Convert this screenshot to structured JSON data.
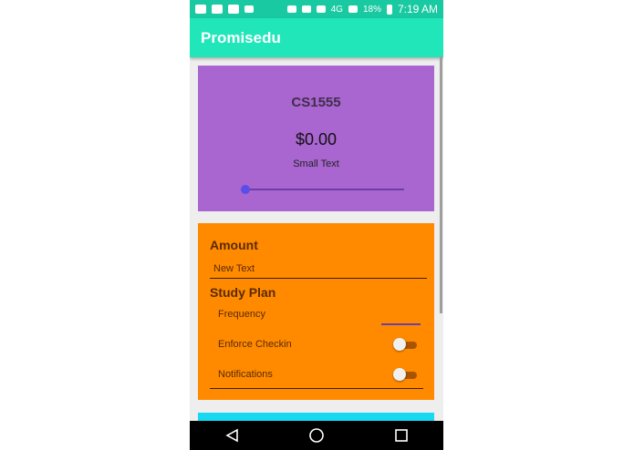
{
  "status_bar": {
    "battery_percent": "18%",
    "time": "7:19 AM",
    "network": "4G"
  },
  "app_bar": {
    "title": "Promisedu"
  },
  "course_card": {
    "course_code": "CS1555",
    "amount": "$0.00",
    "small_text": "Small Text",
    "slider_value": 0,
    "color": "#a965d0"
  },
  "settings_card": {
    "amount_heading": "Amount",
    "amount_input_value": "New Text",
    "study_plan_heading": "Study Plan",
    "frequency_label": "Frequency",
    "enforce_checkin_label": "Enforce Checkin",
    "enforce_checkin_on": false,
    "notifications_label": "Notifications",
    "notifications_on": false,
    "color": "#ff8a00"
  },
  "nav_bar": {
    "back_icon": "back-triangle-icon",
    "home_icon": "home-circle-icon",
    "recents_icon": "recents-square-icon"
  }
}
